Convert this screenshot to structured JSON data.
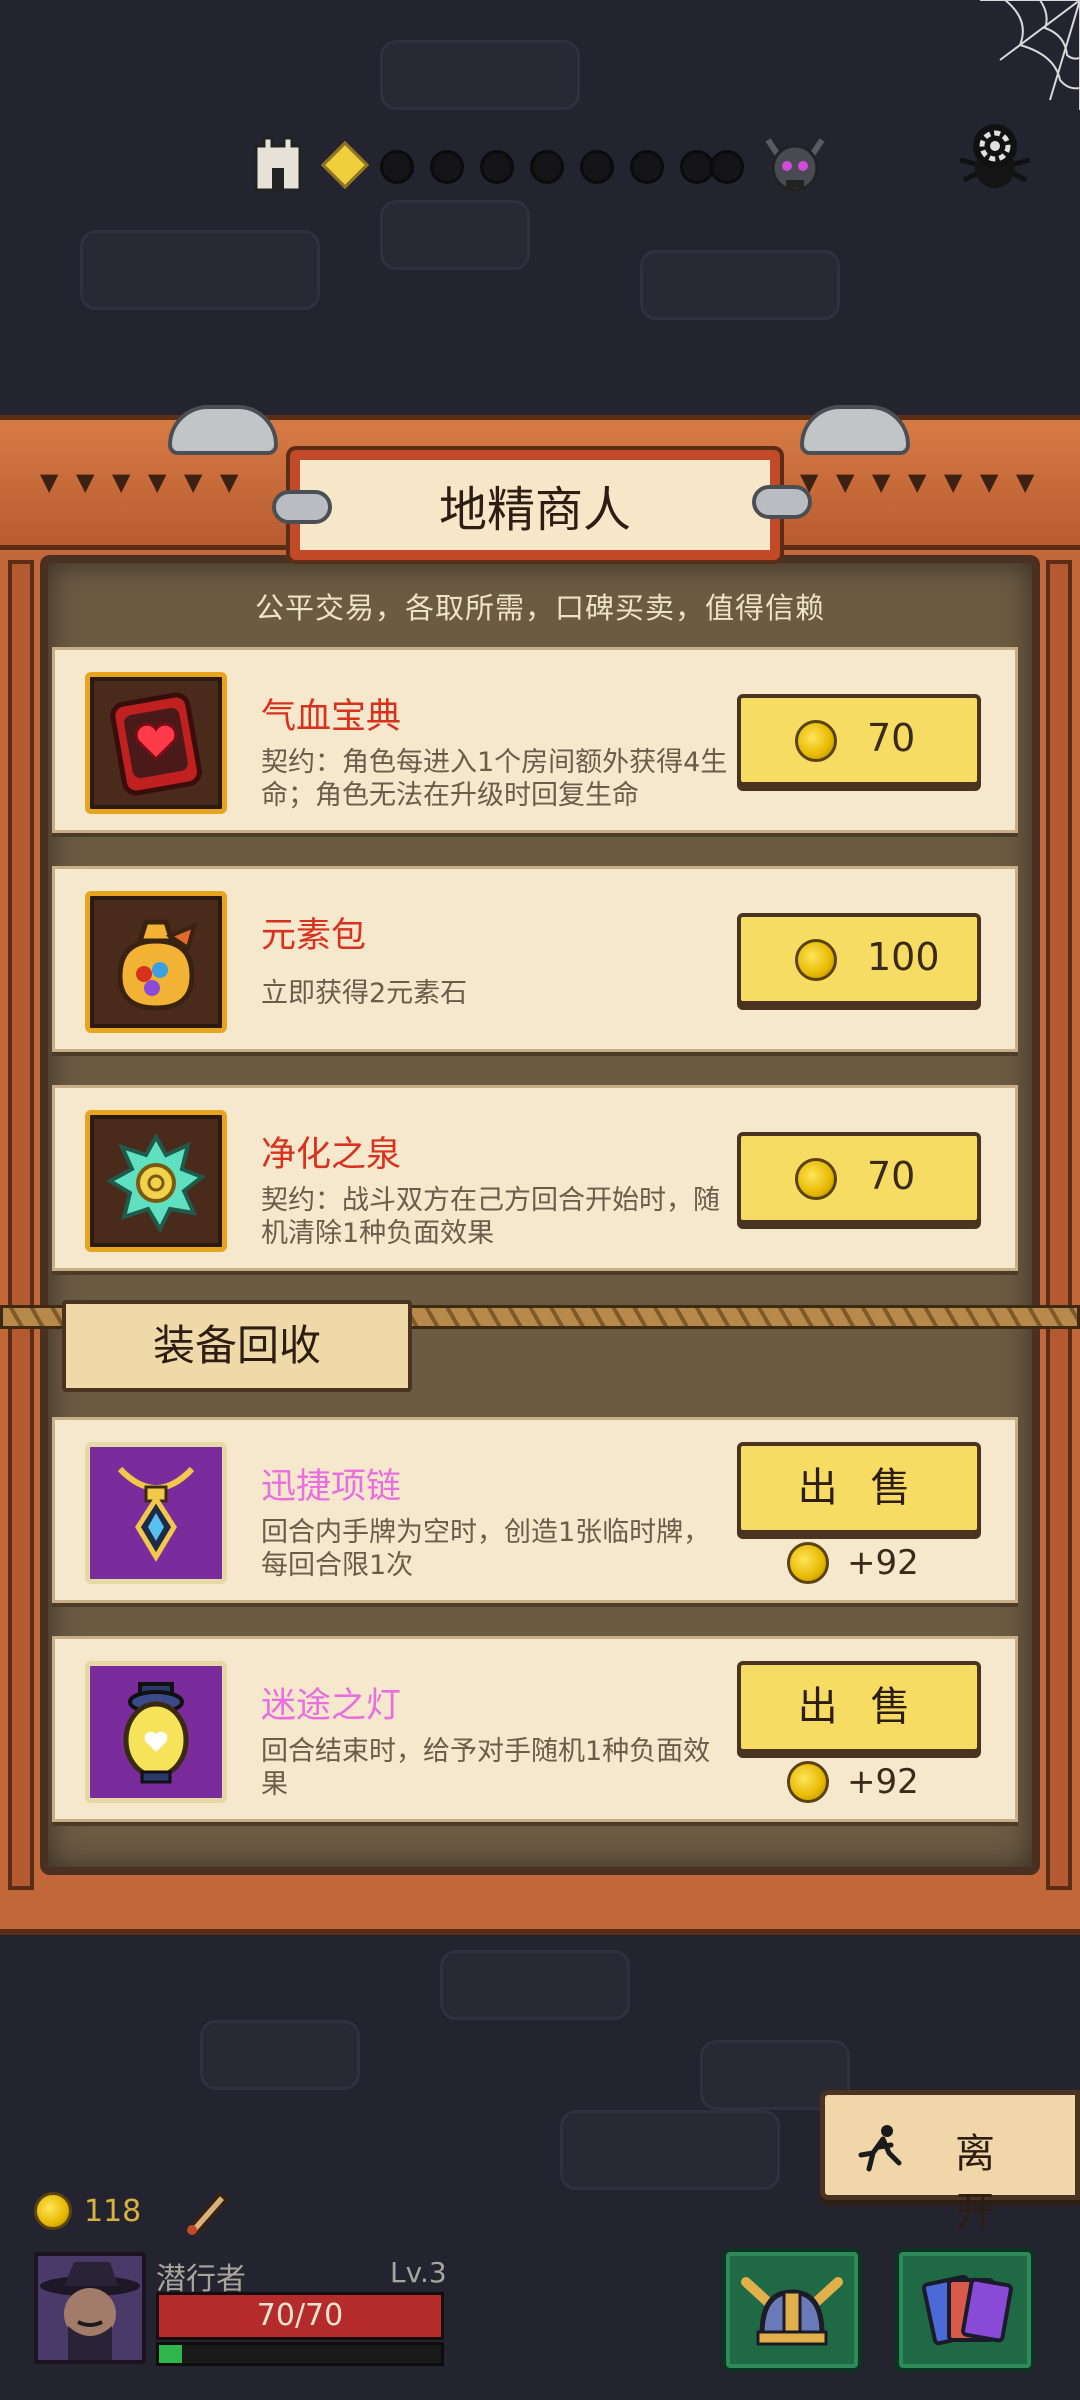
{
  "progress": {
    "nodes_total": 8,
    "current_node_icon": "diamond-icon",
    "start_icon": "tower-icon",
    "end_icon": "boss-skull-icon"
  },
  "shop": {
    "title": "地精商人",
    "subtitle": "公平交易，各取所需，口碑买卖，值得信赖",
    "items": [
      {
        "name": "气血宝典",
        "desc": "契约：角色每进入1个房间额外获得4生命；角色无法在升级时回复生命",
        "price": "70",
        "icon": "heart-book-icon"
      },
      {
        "name": "元素包",
        "desc": "立即获得2元素石",
        "price": "100",
        "icon": "element-bag-icon"
      },
      {
        "name": "净化之泉",
        "desc": "契约：战斗双方在己方回合开始时，随机清除1种负面效果",
        "price": "70",
        "icon": "purify-spring-icon"
      }
    ]
  },
  "recycle": {
    "title": "装备回收",
    "items": [
      {
        "name": "迅捷项链",
        "desc": "回合内手牌为空时，创造1张临时牌，每回合限1次",
        "sell_label": "出 售",
        "gain": "+92",
        "icon": "necklace-icon"
      },
      {
        "name": "迷途之灯",
        "desc": "回合结束时，给予对手随机1种负面效果",
        "sell_label": "出 售",
        "gain": "+92",
        "icon": "lantern-icon"
      }
    ]
  },
  "leave_label": "离 开",
  "player": {
    "gold": "118",
    "name": "潜行者",
    "level": "Lv.3",
    "hp_text": "70/70",
    "hp_fraction": 1.0,
    "xp_fraction": 0.08
  },
  "colors": {
    "accent_red": "#d8321e",
    "rare_pink": "#e96fe0",
    "button_yellow": "#f6dc62",
    "frame_wood": "#c2673a"
  }
}
